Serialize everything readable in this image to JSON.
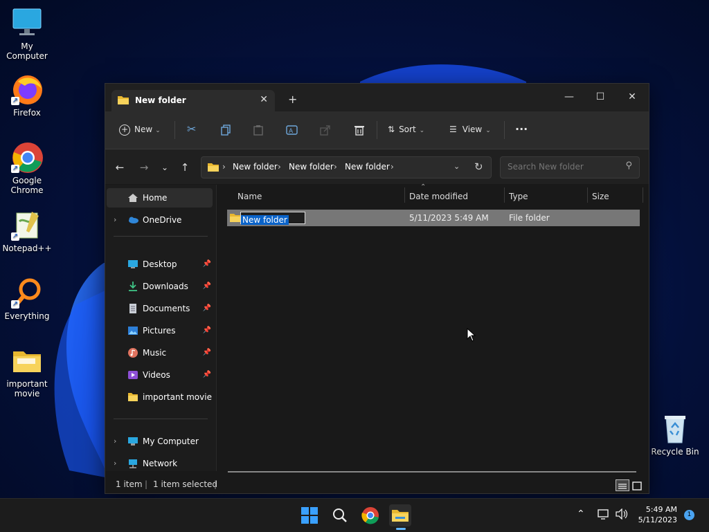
{
  "desktop": {
    "icons": [
      {
        "label": "My Computer",
        "icon": "monitor-icon"
      },
      {
        "label": "Firefox",
        "icon": "firefox-icon"
      },
      {
        "label": "Google Chrome",
        "icon": "chrome-icon"
      },
      {
        "label": "Notepad++",
        "icon": "notepadpp-icon"
      },
      {
        "label": "Everything",
        "icon": "search-magnifier-icon"
      },
      {
        "label": "important movie",
        "icon": "folder-icon"
      },
      {
        "label": "Recycle Bin",
        "icon": "recycle-bin-icon"
      }
    ]
  },
  "window": {
    "tab_title": "New folder",
    "new_tab": "+",
    "toolbar": {
      "new_label": "New",
      "sort_label": "Sort",
      "view_label": "View",
      "more_label": "···"
    },
    "address": {
      "crumbs": [
        "New folder",
        "New folder",
        "New folder"
      ]
    },
    "search": {
      "placeholder": "Search New folder"
    },
    "sidebar": {
      "items": [
        {
          "label": "Home"
        },
        {
          "label": "OneDrive"
        },
        {
          "label": "Desktop"
        },
        {
          "label": "Downloads"
        },
        {
          "label": "Documents"
        },
        {
          "label": "Pictures"
        },
        {
          "label": "Music"
        },
        {
          "label": "Videos"
        },
        {
          "label": "important movie"
        },
        {
          "label": "My Computer"
        },
        {
          "label": "Network"
        }
      ]
    },
    "columns": {
      "name": "Name",
      "date": "Date modified",
      "type": "Type",
      "size": "Size"
    },
    "rows": [
      {
        "name": "New folder",
        "date": "5/11/2023 5:49 AM",
        "type": "File folder",
        "size": ""
      }
    ],
    "status": {
      "count": "1 item",
      "selected": "1 item selected"
    }
  },
  "taskbar": {
    "time": "5:49 AM",
    "date": "5/11/2023",
    "notification_count": "1"
  },
  "colors": {
    "accent": "#0a63c9",
    "folder": "#f4c542",
    "selection": "#777777"
  }
}
